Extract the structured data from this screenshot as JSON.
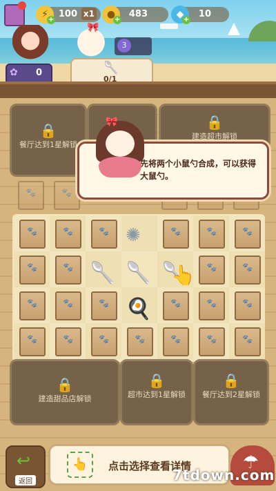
{
  "currency": {
    "energy": {
      "value": "100",
      "multiplier": "x1",
      "icon": "lightning-icon"
    },
    "coins": {
      "value": "483",
      "icon": "coin-icon"
    },
    "gems": {
      "value": "10",
      "icon": "diamond-icon"
    }
  },
  "shop_counter": {
    "count": "0",
    "badge": "3",
    "progress": "0/1"
  },
  "board": {
    "locked_panels_top": [
      {
        "label": "餐厅达到1星解锁"
      },
      {
        "label": ""
      },
      {
        "label": "建造超市解锁"
      }
    ],
    "locked_panels_bottom": [
      {
        "label": "建造甜品店解锁"
      },
      {
        "label": "超市达到1星解锁"
      },
      {
        "label": "餐厅达到2星解锁"
      }
    ]
  },
  "tutorial": {
    "text": "先将两个小鼠勺合成，可以获得大鼠勺。"
  },
  "bottom": {
    "back_label": "返回",
    "detail_label": "点击选择查看详情"
  },
  "watermark": "7tdown.com"
}
